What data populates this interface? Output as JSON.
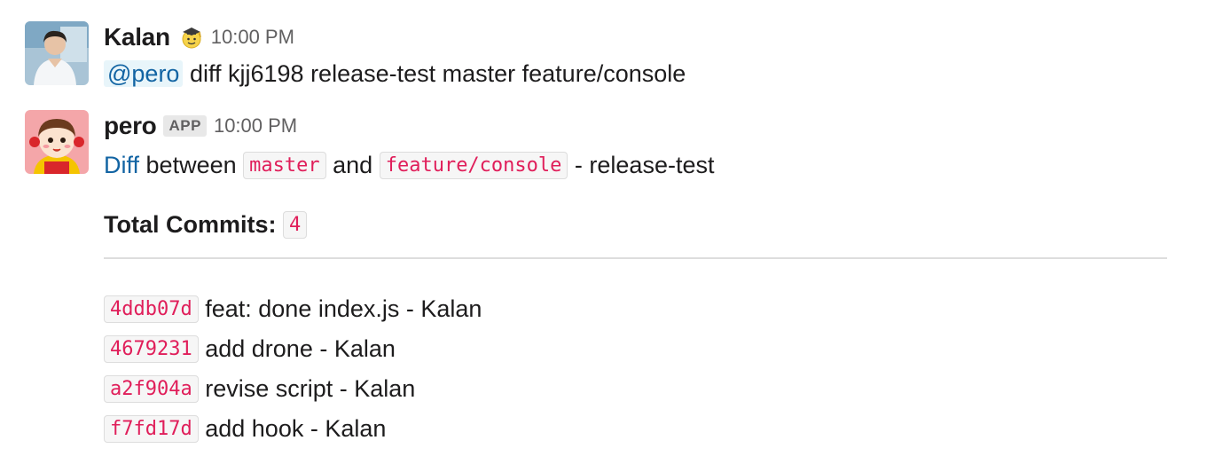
{
  "messages": [
    {
      "sender": "Kalan",
      "status_emoji": "graduation-cap-face",
      "time": "10:00 PM",
      "mention": "@pero",
      "text": "diff kjj6198 release-test master feature/console"
    },
    {
      "sender": "pero",
      "badge": "APP",
      "time": "10:00 PM",
      "diff_link": "Diff",
      "between": "between",
      "base_branch": "master",
      "and": "and",
      "head_branch": "feature/console",
      "suffix": "- release-test",
      "total_label": "Total Commits:",
      "total_count": "4",
      "commits": [
        {
          "hash": "4ddb07d",
          "message": "feat: done index.js - Kalan"
        },
        {
          "hash": "4679231",
          "message": "add drone - Kalan"
        },
        {
          "hash": "a2f904a",
          "message": "revise script - Kalan"
        },
        {
          "hash": "f7fd17d",
          "message": "add hook - Kalan"
        }
      ]
    }
  ]
}
